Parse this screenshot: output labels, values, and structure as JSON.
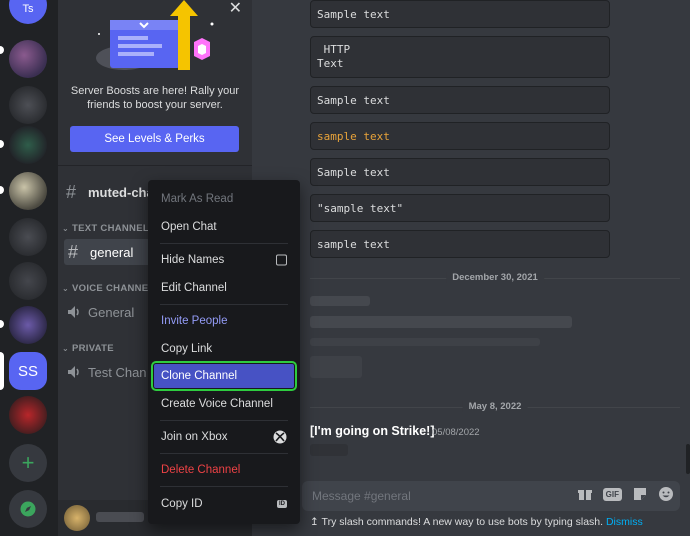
{
  "servers": {
    "top_label": "Ts",
    "active_label": "SS",
    "add_label": "+"
  },
  "boost": {
    "close": "✕",
    "text": "Server Boosts are here! Rally your friends to boost your server.",
    "button": "See Levels & Perks"
  },
  "channels": {
    "muted": "muted-cha",
    "text_category": "TEXT CHANNELS",
    "general": "general",
    "voice_category": "VOICE CHANNEL",
    "voice_general": "General",
    "private_category": "PRIVATE",
    "test_channel": "Test Chan"
  },
  "messages": {
    "code_blocks": [
      "Sample text",
      " HTTP\nText",
      "Sample text",
      "sample text",
      "Sample text",
      "\"sample text\"",
      "sample text"
    ],
    "date1": "December 30, 2021",
    "date2": "May 8, 2022",
    "author": "[I'm going on Strike!]",
    "timestamp": "05/08/2022"
  },
  "composer": {
    "placeholder": "Message #general",
    "gif": "GIF"
  },
  "tip": {
    "arrow": "↥",
    "text": "Try slash commands! A new way to use bots by typing slash.",
    "dismiss": "Dismiss"
  },
  "menu": {
    "mark_read": "Mark As Read",
    "open_chat": "Open Chat",
    "hide_names": "Hide Names",
    "edit_channel": "Edit Channel",
    "invite_people": "Invite People",
    "copy_link": "Copy Link",
    "clone_channel": "Clone Channel",
    "create_voice": "Create Voice Channel",
    "join_xbox": "Join on Xbox",
    "delete_channel": "Delete Channel",
    "copy_id": "Copy ID",
    "id_badge": "ID"
  },
  "colors": {
    "blurple": "#5865f2",
    "highlight_outline": "#2ecc40",
    "danger": "#ed4245",
    "invite": "#949cf7",
    "orange_text": "#e8a33a"
  }
}
